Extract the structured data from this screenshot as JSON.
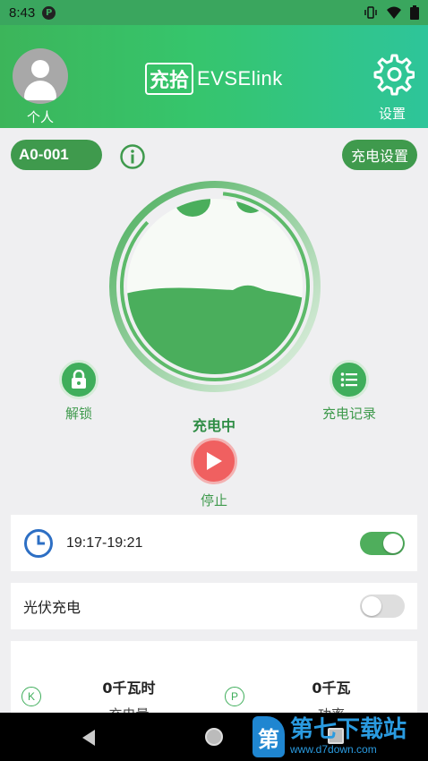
{
  "status_bar": {
    "time": "8:43",
    "app_badge": "P"
  },
  "header": {
    "profile_label": "个人",
    "logo_mark": "充拾",
    "logo_text": "EVSElink",
    "settings_label": "设置"
  },
  "charger": {
    "station_id": "A0-001",
    "settings_button": "充电设置",
    "unlock_label": "解锁",
    "records_label": "充电记录",
    "status": "充电中",
    "stop_label": "停止"
  },
  "schedule": {
    "time_range": "19:17-19:21",
    "enabled": true
  },
  "solar": {
    "label": "光伏充电",
    "enabled": false
  },
  "stats": {
    "energy_badge": "K",
    "energy_value": "0千瓦时",
    "energy_label": "充电量",
    "power_badge": "P",
    "power_value": "0千瓦",
    "power_label": "功率"
  },
  "watermark": {
    "logo_char": "第",
    "text": "第七下载站",
    "url": "www.d7down.com"
  },
  "colors": {
    "brand_green": "#3f9a4d",
    "header_gradient_end": "#2ec59a",
    "stop_red": "#f06060"
  },
  "icons": [
    "person-icon",
    "gear-icon",
    "info-icon",
    "lock-icon",
    "list-icon",
    "play-icon",
    "clock-icon",
    "back-icon",
    "home-icon",
    "recents-icon"
  ]
}
